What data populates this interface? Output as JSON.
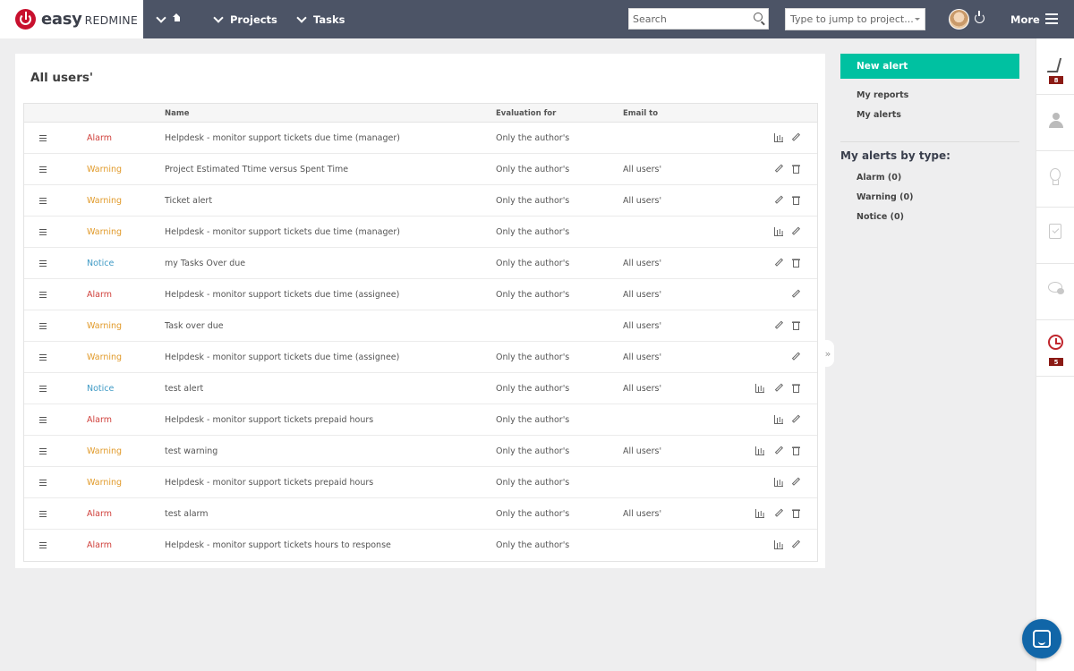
{
  "brand": {
    "name_easy": "easy",
    "name_redmine": "REDMINE",
    "color": "#c8102e"
  },
  "topnav": {
    "home_icon": "home-icon",
    "projects_label": "Projects",
    "tasks_label": "Tasks",
    "search_placeholder": "Search",
    "jump_placeholder": "Type to jump to project...",
    "more_label": "More"
  },
  "page": {
    "title": "All users'"
  },
  "table": {
    "columns": [
      "",
      "",
      "Name",
      "Evaluation for",
      "Email to",
      ""
    ],
    "rows": [
      {
        "type": "Alarm",
        "name": "Helpdesk - monitor support tickets due time (manager)",
        "eval": "Only the author's",
        "email": "",
        "actions": [
          "chart",
          "edit"
        ]
      },
      {
        "type": "Warning",
        "name": "Project Estimated Ttime versus Spent Time",
        "eval": "Only the author's",
        "email": "All users'",
        "actions": [
          "edit",
          "delete"
        ]
      },
      {
        "type": "Warning",
        "name": "Ticket alert",
        "eval": "Only the author's",
        "email": "All users'",
        "actions": [
          "edit",
          "delete"
        ]
      },
      {
        "type": "Warning",
        "name": "Helpdesk - monitor support tickets due time (manager)",
        "eval": "Only the author's",
        "email": "",
        "actions": [
          "chart",
          "edit"
        ]
      },
      {
        "type": "Notice",
        "name": "my Tasks Over due",
        "eval": "Only the author's",
        "email": "All users'",
        "actions": [
          "edit",
          "delete"
        ]
      },
      {
        "type": "Alarm",
        "name": "Helpdesk - monitor support tickets due time (assignee)",
        "eval": "Only the author's",
        "email": "All users'",
        "actions": [
          "edit"
        ]
      },
      {
        "type": "Warning",
        "name": "Task over due",
        "eval": "",
        "email": "All users'",
        "actions": [
          "edit",
          "delete"
        ]
      },
      {
        "type": "Warning",
        "name": "Helpdesk - monitor support tickets due time (assignee)",
        "eval": "Only the author's",
        "email": "All users'",
        "actions": [
          "edit"
        ]
      },
      {
        "type": "Notice",
        "name": "test alert",
        "eval": "Only the author's",
        "email": "All users'",
        "actions": [
          "chart",
          "edit",
          "delete"
        ]
      },
      {
        "type": "Alarm",
        "name": "Helpdesk - monitor support tickets prepaid hours",
        "eval": "Only the author's",
        "email": "",
        "actions": [
          "chart",
          "edit"
        ]
      },
      {
        "type": "Warning",
        "name": "test warning",
        "eval": "Only the author's",
        "email": "All users'",
        "actions": [
          "chart",
          "edit",
          "delete"
        ]
      },
      {
        "type": "Warning",
        "name": "Helpdesk - monitor support tickets prepaid hours",
        "eval": "Only the author's",
        "email": "",
        "actions": [
          "chart",
          "edit"
        ]
      },
      {
        "type": "Alarm",
        "name": "test alarm",
        "eval": "Only the author's",
        "email": "All users'",
        "actions": [
          "chart",
          "edit",
          "delete"
        ]
      },
      {
        "type": "Alarm",
        "name": "Helpdesk - monitor support tickets hours to response",
        "eval": "Only the author's",
        "email": "",
        "actions": [
          "chart",
          "edit"
        ]
      }
    ]
  },
  "sidebar": {
    "new_alert_label": "New alert",
    "new_alert_color": "#00c1a1",
    "links": [
      "My reports",
      "My alerts"
    ],
    "by_type_heading": "My alerts by type:",
    "by_type": [
      "Alarm (0)",
      "Warning (0)",
      "Notice (0)"
    ],
    "collapse_glyph": "»"
  },
  "rail": {
    "activity_badge": "8",
    "history_badge": "5",
    "icons": [
      "activity-icon",
      "user-icon",
      "bulb-icon",
      "clipboard-icon",
      "chat-icon",
      "history-icon"
    ]
  },
  "colors": {
    "alarm": "#d0403b",
    "warning": "#e19a2a",
    "notice": "#3f9ac5",
    "topbar": "#4c5466"
  }
}
